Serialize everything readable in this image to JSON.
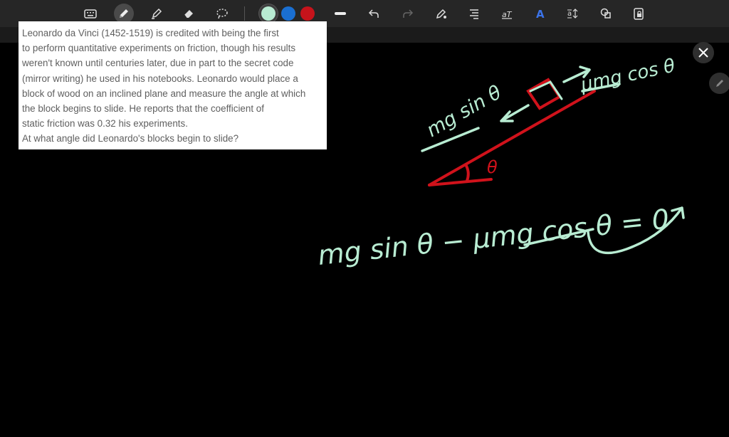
{
  "toolbar": {
    "tools": [
      {
        "name": "keyboard-icon",
        "tooltip": ""
      },
      {
        "name": "pen-icon",
        "active": true
      },
      {
        "name": "highlighter-icon"
      },
      {
        "name": "eraser-icon"
      },
      {
        "name": "lasso-icon"
      }
    ],
    "colors": [
      "#b8ecd2",
      "#1a6fd1",
      "#c6131b"
    ],
    "selected_color": "#b8ecd2"
  },
  "question": {
    "lines": [
      "Leonardo da Vinci (1452-1519) is credited with being the first",
      "to perform quantitative experiments on friction, though his results",
      "weren't known until centuries later, due in part to the secret code",
      "(mirror writing) he used in his notebooks. Leonardo would place a",
      "block of wood on an inclined plane and measure the angle at which",
      "the block begins to slide. He reports that the coefficient of",
      "static friction was 0.32 his experiments.",
      "At what angle did Leonardo's blocks begin to slide?"
    ]
  },
  "handwriting": {
    "force_down_slope": "mg sin θ",
    "friction_force": "μmg cos θ",
    "angle_label": "θ",
    "equation": "mg sin θ − μmg cos θ = 0"
  },
  "colors": {
    "ink": "#b8ecd2",
    "red_ink": "#d0121b",
    "toolbar_bg": "#262626",
    "canvas_bg": "#000000"
  }
}
